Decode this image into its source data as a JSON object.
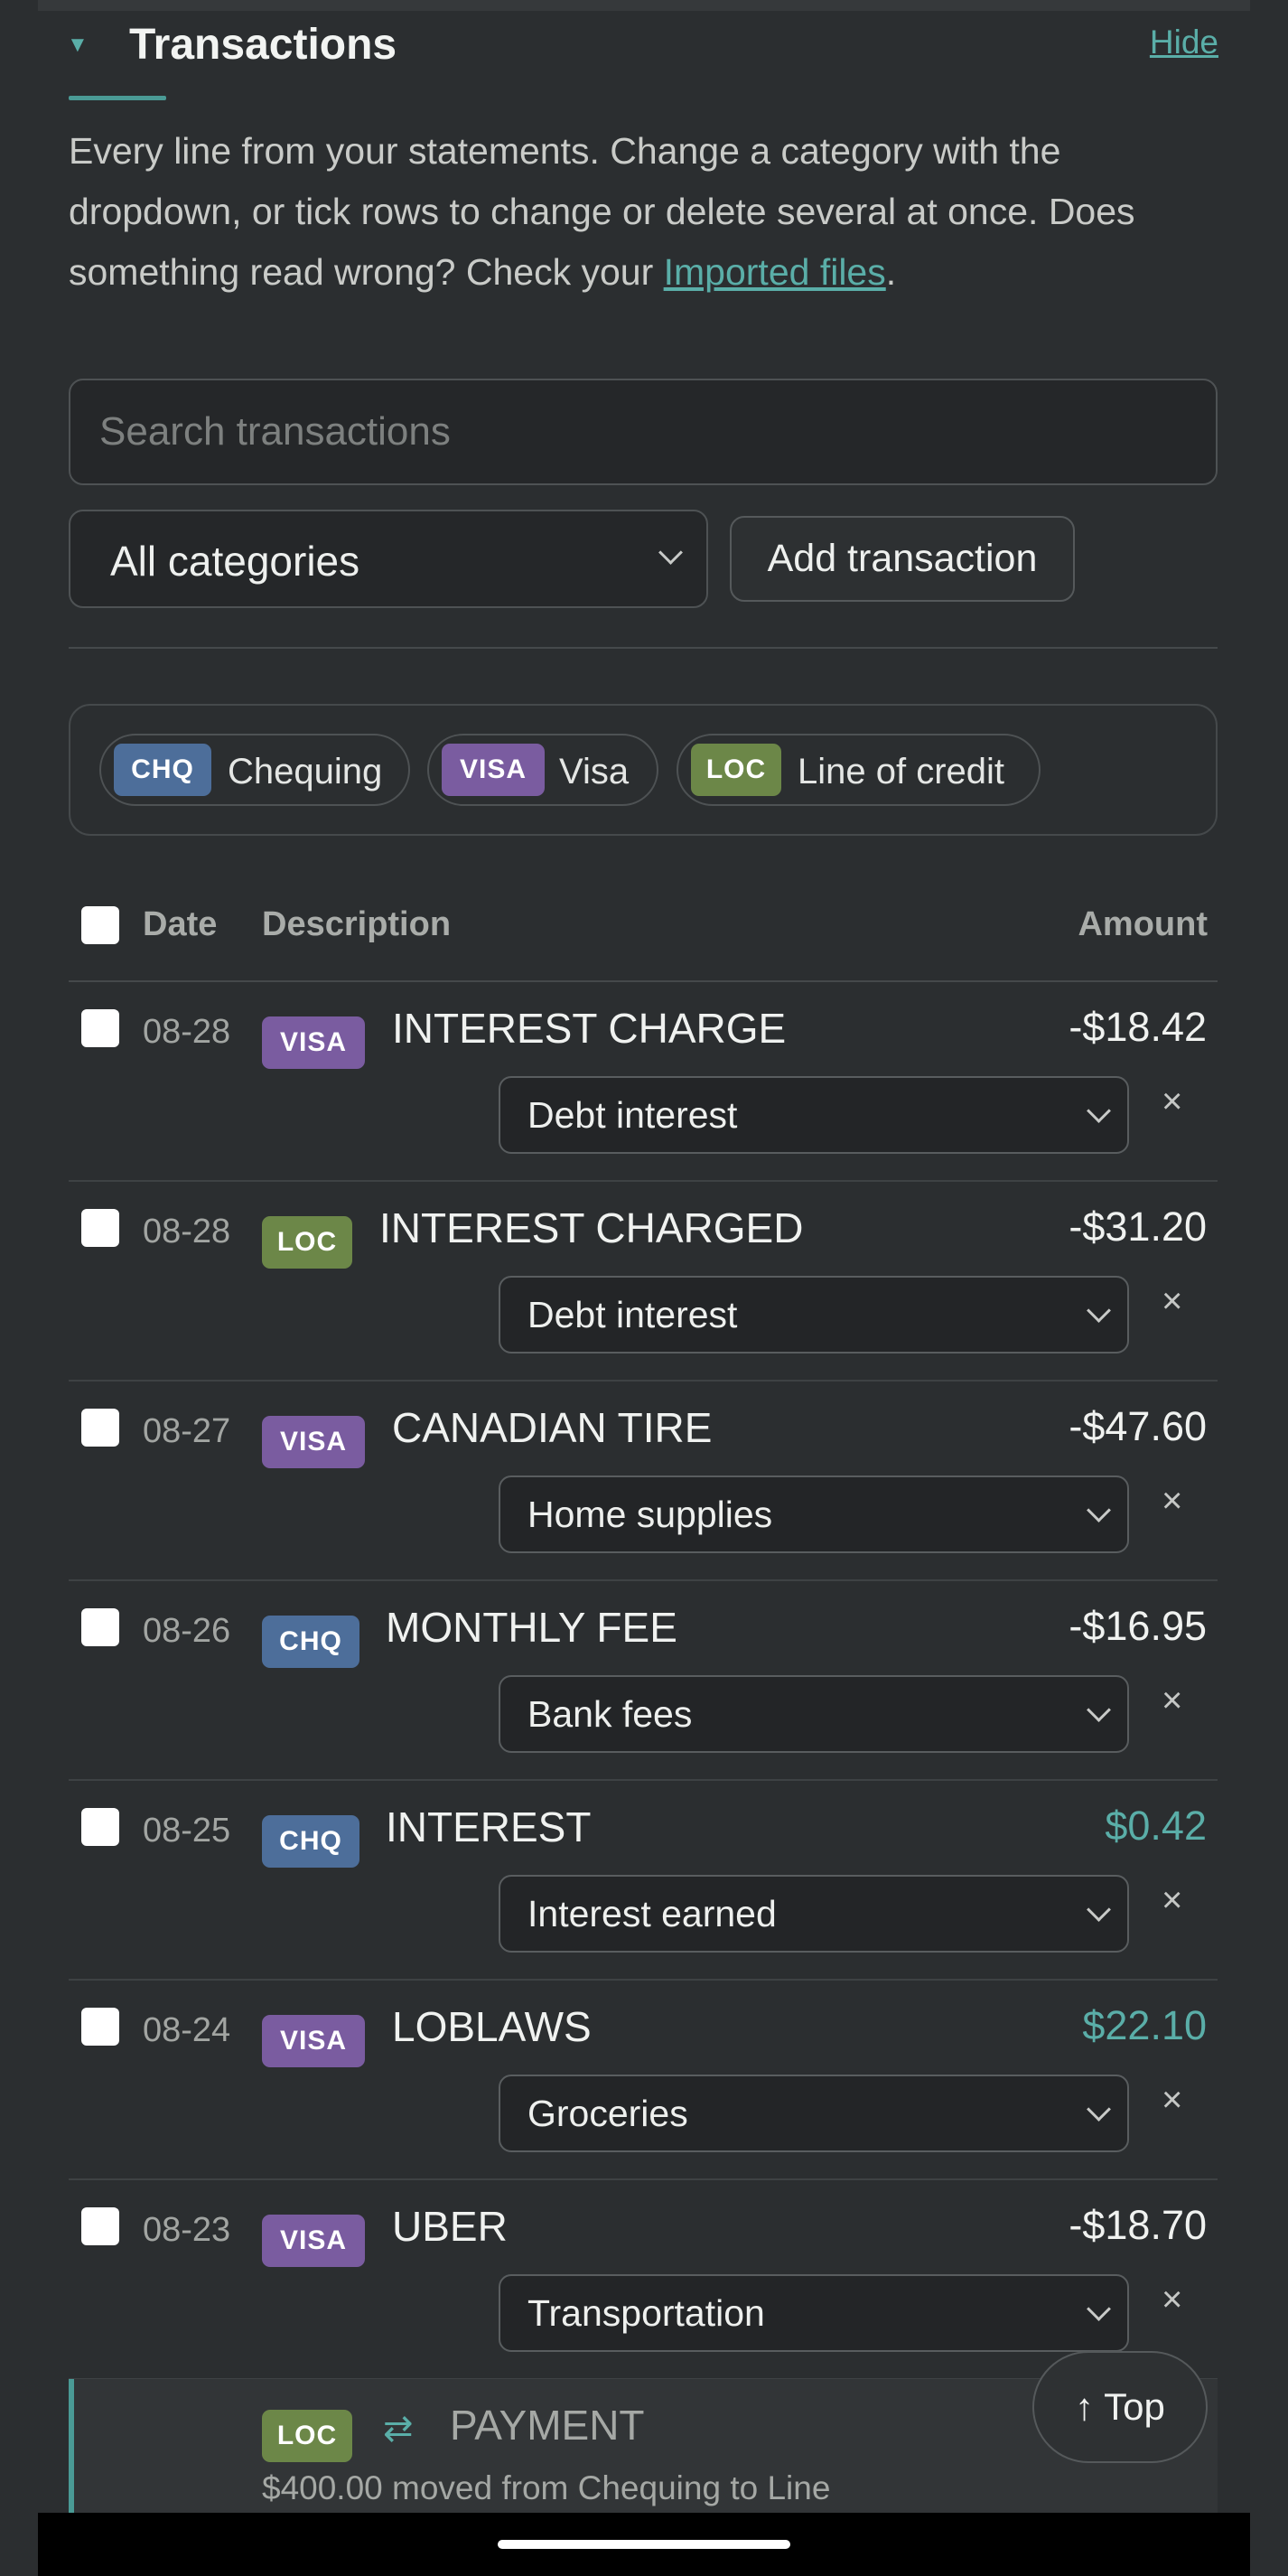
{
  "section": {
    "title": "Transactions",
    "hide_label": "Hide",
    "intro_text": "Every line from your statements. Change a category with the dropdown, or tick rows to change or delete several at once. Does something read wrong? Check your ",
    "intro_link": "Imported files",
    "intro_end": "."
  },
  "search": {
    "placeholder": "Search transactions",
    "value": ""
  },
  "category_filter": {
    "selected": "All categories"
  },
  "add_transaction_label": "Add transaction",
  "accounts": [
    {
      "badge": "CHQ",
      "label": "Chequing",
      "color": "#4d6e9a"
    },
    {
      "badge": "VISA",
      "label": "Visa",
      "color": "#7a5ca0"
    },
    {
      "badge": "LOC",
      "label": "Line of credit",
      "color": "#6c8748"
    }
  ],
  "table": {
    "headers": {
      "date": "Date",
      "description": "Description",
      "amount": "Amount"
    },
    "rows": [
      {
        "date": "08-28",
        "account": "VISA",
        "description": "INTEREST CHARGE",
        "amount": "-$18.42",
        "category": "Debt interest"
      },
      {
        "date": "08-28",
        "account": "LOC",
        "description": "INTEREST CHARGED",
        "amount": "-$31.20",
        "category": "Debt interest"
      },
      {
        "date": "08-27",
        "account": "VISA",
        "description": "CANADIAN TIRE",
        "amount": "-$47.60",
        "category": "Home supplies"
      },
      {
        "date": "08-26",
        "account": "CHQ",
        "description": "MONTHLY FEE",
        "amount": "-$16.95",
        "category": "Bank fees"
      },
      {
        "date": "08-25",
        "account": "CHQ",
        "description": "INTEREST",
        "amount": "$0.42",
        "category": "Interest earned"
      },
      {
        "date": "08-24",
        "account": "VISA",
        "description": "LOBLAWS",
        "amount": "$22.10",
        "category": "Groceries"
      },
      {
        "date": "08-23",
        "account": "VISA",
        "description": "UBER",
        "amount": "-$18.70",
        "category": "Transportation"
      }
    ],
    "delete_glyph": "×"
  },
  "transfer": {
    "account": "LOC",
    "icon": "swap-arrows-icon",
    "glyph": "⇄",
    "title": "PAYMENT",
    "subtitle": "$400.00 moved from Chequing to Line"
  },
  "top_button_label": "↑ Top",
  "colors": {
    "accent": "#5aaea8",
    "chq": "#4d6e9a",
    "visa": "#7a5ca0",
    "loc": "#6c8748",
    "positive_amount": "#5aaea8"
  }
}
